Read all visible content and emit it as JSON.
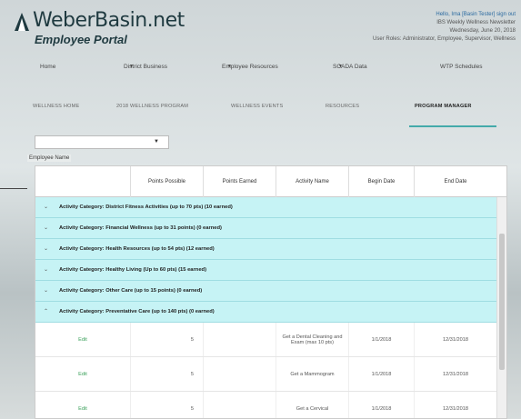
{
  "header": {
    "site_title": "WeberBasin.net",
    "subtitle": "Employee Portal",
    "user_line": "Hello, Ima  [Basin Tester]  sign out",
    "info_line_1": "IBS Weekly Wellness Newsletter",
    "info_line_2": "Wednesday, June 20, 2018",
    "info_line_3": "User Roles: Administrator, Employee, Supervisor, Wellness"
  },
  "topnav": {
    "items": [
      "Home",
      "District Business",
      "Employee Resources",
      "SCADA Data",
      "WTP Schedules"
    ]
  },
  "subnav": {
    "items": [
      "WELLNESS HOME",
      "2018 WELLNESS PROGRAM",
      "WELLNESS EVENTS",
      "RESOURCES",
      "PROGRAM MANAGER"
    ]
  },
  "filter": {
    "employee_label": "Employee Name"
  },
  "grid": {
    "columns": [
      "",
      "Points Possible",
      "Points Earned",
      "Activity Name",
      "Begin Date",
      "End Date"
    ],
    "categories": [
      "Activity Category: District Fitness Activities (up to 70 pts) (10 earned)",
      "Activity Category: Financial Wellness (up to 31 points) (0 earned)",
      "Activity Category: Health Resources (up to 54 pts) (12 earned)",
      "Activity Category: Healthy Living (Up to 60 pts) (15 earned)",
      "Activity Category: Other Care (up to 15 points) (0 earned)",
      "Activity Category: Preventative Care (up to 140 pts) (0 earned)"
    ],
    "rows": [
      {
        "action": "Edit",
        "points_possible": "5",
        "points_earned": "",
        "activity": "Get a Dental Cleaning and Exam (max 10 pts)",
        "begin": "1/1/2018",
        "end": "12/31/2018"
      },
      {
        "action": "Edit",
        "points_possible": "5",
        "points_earned": "",
        "activity": "Get a Mammogram",
        "begin": "1/1/2018",
        "end": "12/31/2018"
      },
      {
        "action": "Edit",
        "points_possible": "5",
        "points_earned": "",
        "activity": "Get a Cervical",
        "begin": "1/1/2018",
        "end": "12/31/2018"
      }
    ]
  },
  "colors": {
    "category_bg": "#c6f3f5",
    "accent": "#44aaaa",
    "edit_link": "#3aa05a"
  }
}
